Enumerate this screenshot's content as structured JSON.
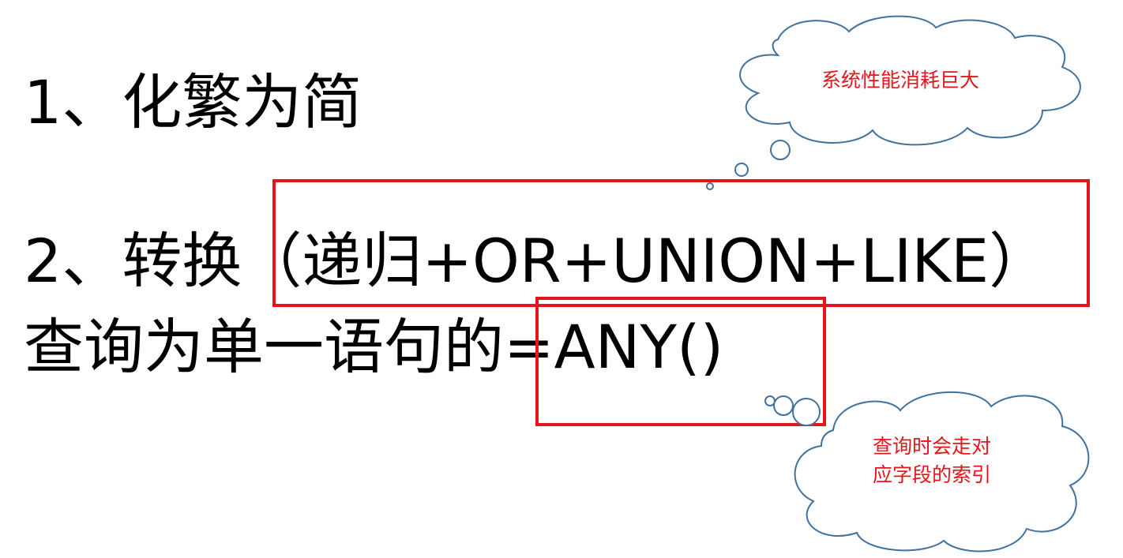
{
  "slide": {
    "line1": "1、化繁为简",
    "line2": "2、转换（递归+OR+UNION+LIKE）",
    "line3": "查询为单一语句的=ANY()"
  },
  "callouts": {
    "top": "系统性能消耗巨大",
    "bottom_line1": "查询时会走对",
    "bottom_line2": "应字段的索引"
  },
  "colors": {
    "text": "#000000",
    "highlight": "#e8141b",
    "cloud_outline": "#41719c"
  }
}
